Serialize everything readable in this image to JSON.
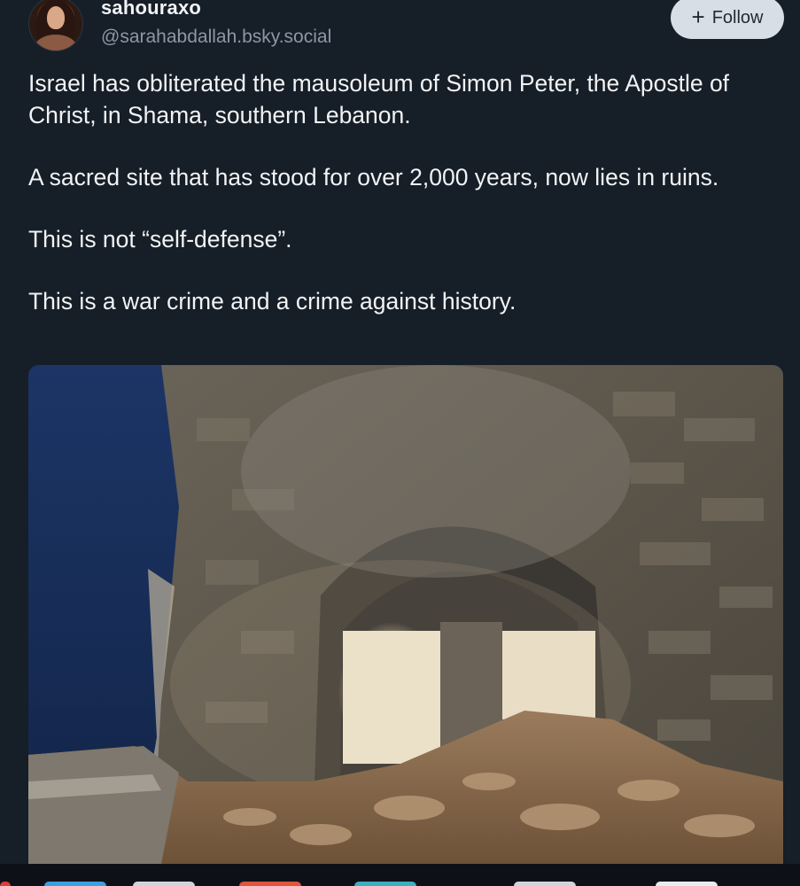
{
  "author": {
    "display_name": "sahouraxo",
    "handle": "@sarahabdallah.bsky.social"
  },
  "follow_button": {
    "icon": "plus-icon",
    "label": "Follow"
  },
  "post": {
    "paragraphs": [
      "Israel has obliterated the mausoleum of Simon Peter, the Apostle of Christ, in Shama, southern Lebanon.",
      "A sacred site that has stood for over 2,000 years, now lies in ruins.",
      "This is not “self-defense”.",
      "This is a war crime and a crime against history."
    ]
  },
  "colors": {
    "background": "#161e27",
    "text": "#f1f3f5",
    "handle": "#8c98a7",
    "follow_bg": "#d7dee6"
  }
}
